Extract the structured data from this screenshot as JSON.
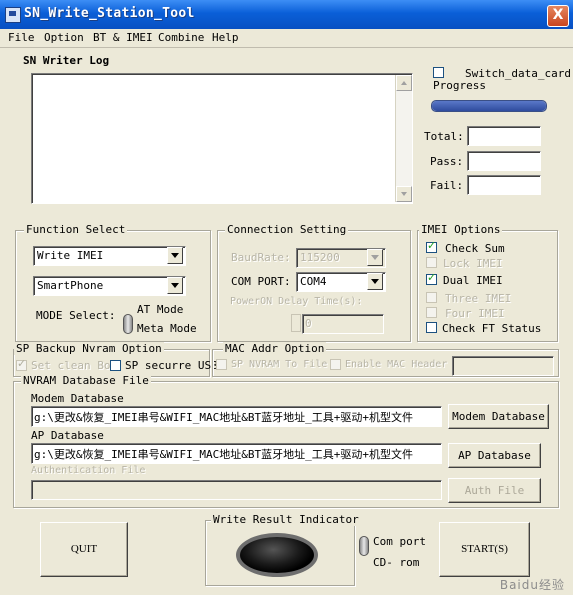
{
  "window": {
    "title": "SN_Write_Station_Tool",
    "close_symbol": "X"
  },
  "menu": [
    "File",
    "Option",
    "BT & IMEI",
    "Combine",
    "Help"
  ],
  "log": {
    "title": "SN Writer Log"
  },
  "right_panel": {
    "switch_data_card": "Switch_data_card",
    "progress_label": "Progress",
    "progress_value": 1.0,
    "total_label": "Total:",
    "pass_label": "Pass:",
    "fail_label": "Fail:"
  },
  "function_select": {
    "title": "Function Select",
    "function_value": "Write IMEI",
    "phone_value": "SmartPhone",
    "mode_label": "MODE Select:",
    "at_mode": "AT Mode",
    "meta_mode": "Meta Mode"
  },
  "connection": {
    "title": "Connection Setting",
    "baud_label": "BaudRate:",
    "baud_value": "115200",
    "com_label": "COM PORT:",
    "com_value": "COM4",
    "delay_label": "PowerON Delay Time(s):",
    "delay_value": "0"
  },
  "imei_options": {
    "title": "IMEI Options",
    "check_sum": "Check Sum",
    "lock_imei": "Lock IMEI",
    "dual_imei": "Dual IMEI",
    "three_imei": "Three IMEI",
    "four_imei": "Four IMEI",
    "check_ft": "Check FT Status"
  },
  "sp_backup": {
    "title": "SP Backup Nvram Option",
    "set_clean": "Set clean Boo",
    "sp_secure": "SP securre USB"
  },
  "mac_addr": {
    "title": "MAC Addr Option",
    "sp_nvram": "SP NVRAM To File",
    "enable_mac": "Enable MAC Header"
  },
  "nvram_db": {
    "title": "NVRAM Database File",
    "modem_label": "Modem Database",
    "modem_path": "g:\\更改&恢复_IMEI串号&WIFI_MAC地址&BT蓝牙地址_工具+驱动+机型文件",
    "modem_button": "Modem Database",
    "ap_label": "AP Database",
    "ap_path": "g:\\更改&恢复_IMEI串号&WIFI_MAC地址&BT蓝牙地址_工具+驱动+机型文件",
    "ap_button": "AP Database",
    "auth_label": "Authentication File",
    "auth_button": "Auth File"
  },
  "bottom": {
    "quit": "QUIT",
    "indicator_title": "Write Result Indicator",
    "com_port": "Com port",
    "cd_rom": "CD- rom",
    "start": "START(S)"
  },
  "watermark": "Baidu经验"
}
